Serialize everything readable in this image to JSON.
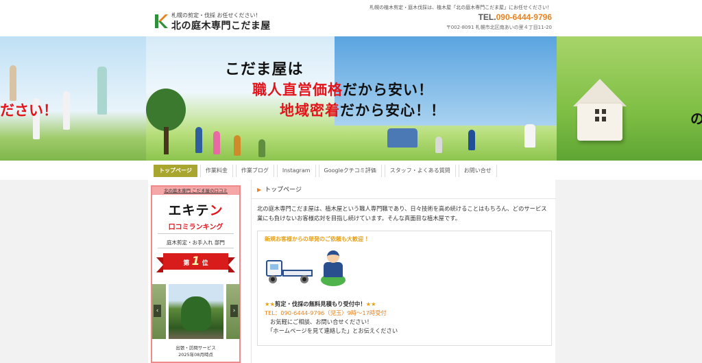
{
  "header": {
    "logo_tagline": "札幌の剪定・伐採 お任せください！",
    "logo_name": "北の庭木専門こだま屋",
    "note": "札幌の植木剪定・庭木伐採は、植木屋「北の庭木専門こだま屋」にお任せください！",
    "tel_prefix": "TEL.",
    "tel_number": "090-6444-9796",
    "address": "〒002-8091 札幌市北区南あいの里４丁目11-20"
  },
  "banner": {
    "left_word": "ださい！",
    "line1": "こだま屋は",
    "line2_red": "職人直営価格",
    "line2_rest": "だから安い！",
    "line3_red": "地域密着",
    "line3_rest": "だから安心！！",
    "right_word": "の"
  },
  "nav": {
    "items": [
      {
        "label": "トップページ"
      },
      {
        "label": "作業料金"
      },
      {
        "label": "作業ブログ"
      },
      {
        "label": "Instagram"
      },
      {
        "label": "Googleクチコミ評価"
      },
      {
        "label": "スタッフ・よくある質問"
      },
      {
        "label": "お問い合せ"
      }
    ]
  },
  "sidebar": {
    "title": "北の庭木専門 こだま屋の口コミ",
    "ekiten_main": "エキテ",
    "ekiten_end": "ン",
    "ranking": "口コミランキング",
    "category": "庭木剪定・お手入れ 部門",
    "rank_prefix": "第",
    "rank_number": "1",
    "rank_suffix": "位",
    "caption1": "出張・訪問サービス",
    "caption2": "2025年08月時点",
    "arrow_left": "‹",
    "arrow_right": "›"
  },
  "main": {
    "breadcrumb": "トップページ",
    "intro": "北の庭木専門こだま屋は、植木屋という職人専門職であり、日々技術を高め続けることはもちろん、どのサービス業にも負けないお客様応対を目指し続けています。そんな真面目な植木屋です。",
    "box_head": "新規お客様からの単発のご依頼も大歓迎 ！",
    "free_stars_l": "★★",
    "free_text": "剪定・伐採の無料見積もり受付中！",
    "free_stars_r": "★★",
    "tel_line": "TEL：090-6444-9796（児玉）9時～17時受付",
    "line3": "お気軽にご相談、お問い合せください！",
    "line4": "「ホームページを見て連絡した」とお伝えください"
  },
  "colors": {
    "accent_orange": "#e8821e",
    "nav_active": "#a8a62e",
    "red": "#e4141b"
  }
}
